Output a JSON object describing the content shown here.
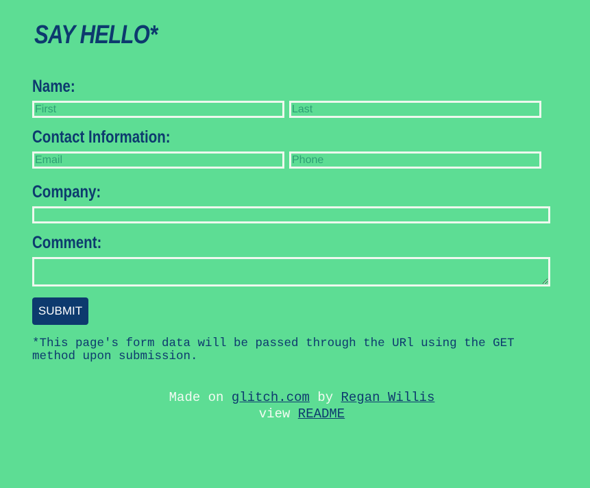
{
  "title": "SAY HELLO*",
  "form": {
    "name_label": "Name:",
    "first_placeholder": "First",
    "last_placeholder": "Last",
    "contact_label": "Contact Information:",
    "email_placeholder": "Email",
    "phone_placeholder": "Phone",
    "company_label": "Company:",
    "comment_label": "Comment:",
    "submit_label": "SUBMIT"
  },
  "note": "*This page's form data will be passed through the URl using the GET method upon submission.",
  "footer": {
    "made_on": "Made on",
    "glitch_link": "glitch.com",
    "by": "by",
    "author_link": "Regan Willis",
    "view": "view",
    "readme_link": "README"
  },
  "colors": {
    "background": "#5ddd94",
    "primary": "#0d3a6e",
    "field_border": "#eef8ee"
  }
}
